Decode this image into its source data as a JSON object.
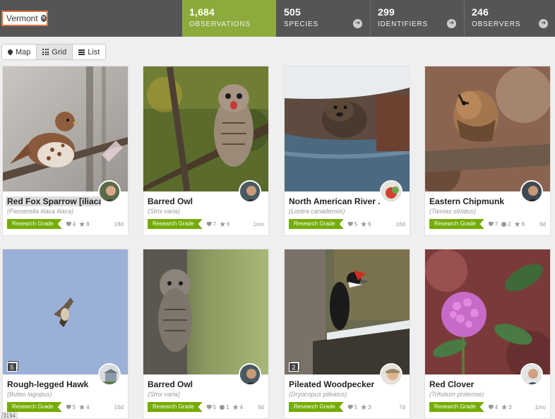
{
  "place": {
    "label": "Vermont"
  },
  "stats": {
    "observations": {
      "value": "1,684",
      "label": "OBSERVATIONS"
    },
    "species": {
      "value": "505",
      "label": "SPECIES"
    },
    "identifiers": {
      "value": "299",
      "label": "IDENTIFIERS"
    },
    "observers": {
      "value": "246",
      "label": "OBSERVERS"
    }
  },
  "views": [
    {
      "label": "Map",
      "icon": "map-pin-icon"
    },
    {
      "label": "Grid",
      "icon": "grid-icon"
    },
    {
      "label": "List",
      "icon": "list-icon"
    }
  ],
  "active_view": "Grid",
  "quality_label": "Research Grade",
  "colors": {
    "research_grade": "#74ac00",
    "observations_bg": "#8dab3c",
    "header_bg": "#555555",
    "place_border": "#e0733a"
  },
  "cards": [
    {
      "title": "Red Fox Sparrow [iliaca]",
      "scientific": "(Passerella iliaca iliaca)",
      "ids": "4",
      "comments": "",
      "faves": "8",
      "age": "18d",
      "photo_count": ""
    },
    {
      "title": "Barred Owl",
      "scientific": "(Strix varia)",
      "ids": "7",
      "comments": "",
      "faves": "6",
      "age": "1mo",
      "photo_count": ""
    },
    {
      "title": "North American River ...",
      "scientific": "(Lontra canadensis)",
      "ids": "5",
      "comments": "",
      "faves": "6",
      "age": "16d",
      "photo_count": ""
    },
    {
      "title": "Eastern Chipmunk",
      "scientific": "(Tamias striatus)",
      "ids": "7",
      "comments": "2",
      "faves": "6",
      "age": "6d",
      "photo_count": ""
    },
    {
      "title": "Rough-legged Hawk",
      "scientific": "(Buteo lagopus)",
      "ids": "5",
      "comments": "",
      "faves": "4",
      "age": "16d",
      "photo_count": "5"
    },
    {
      "title": "Barred Owl",
      "scientific": "(Strix varia)",
      "ids": "5",
      "comments": "1",
      "faves": "4",
      "age": "9d",
      "photo_count": ""
    },
    {
      "title": "Pileated Woodpecker",
      "scientific": "(Dryocopus pileatus)",
      "ids": "5",
      "comments": "",
      "faves": "3",
      "age": "7d",
      "photo_count": "2"
    },
    {
      "title": "Red Clover",
      "scientific": "(Trifolium pratense)",
      "ids": "4",
      "comments": "",
      "faves": "3",
      "age": "1mo",
      "photo_count": ""
    }
  ],
  "status_url_fragment": "/3194"
}
